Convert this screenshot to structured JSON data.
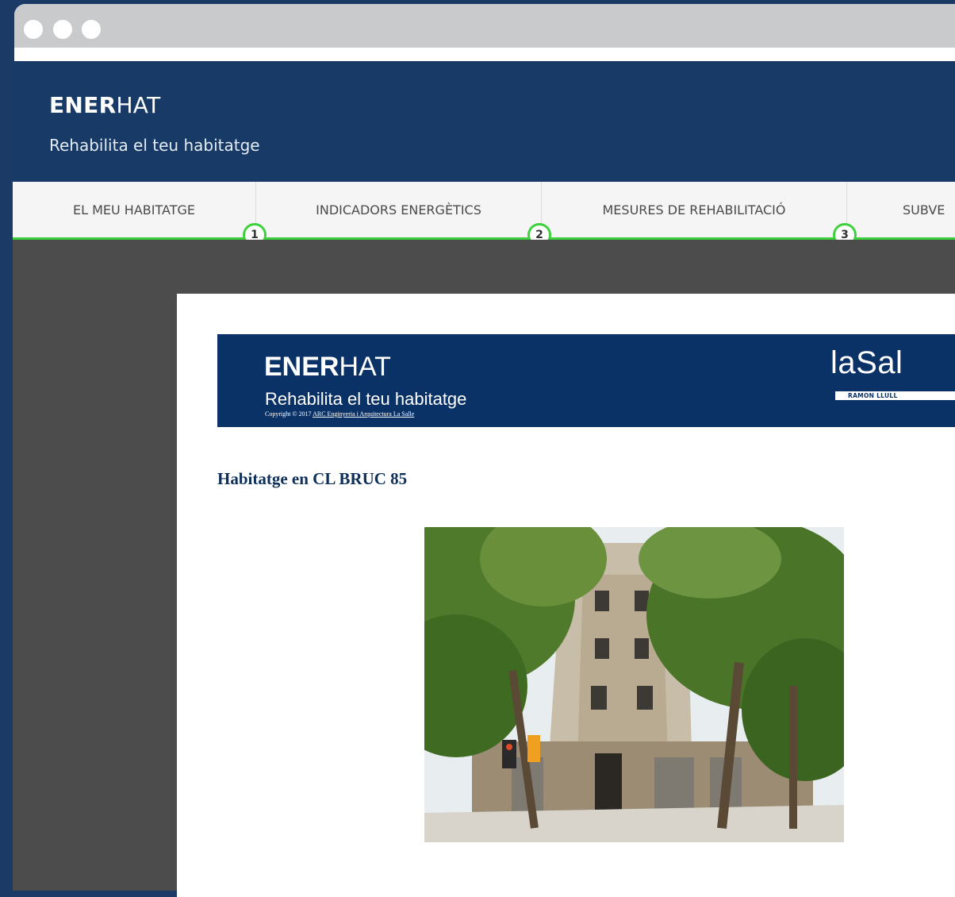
{
  "site": {
    "brand_bold": "ENER",
    "brand_light": "HAT",
    "tagline": "Rehabilita el teu habitatge"
  },
  "nav": {
    "items": [
      {
        "label": "EL MEU HABITATGE"
      },
      {
        "label": "INDICADORS ENERGÈTICS"
      },
      {
        "label": "MESURES DE REHABILITACIÓ"
      },
      {
        "label": "SUBVE"
      }
    ],
    "steps": [
      "1",
      "2",
      "3"
    ]
  },
  "document": {
    "banner": {
      "brand_bold": "ENER",
      "brand_light": "HAT",
      "tagline": "Rehabilita el teu habitatge",
      "copyright_prefix": "Copyright © 2017 ",
      "copyright_link": "ARC Enginyeria i Arquitectura La Salle",
      "partner_logo_text": "laSal",
      "partner_logo_subtext": "RAMON LLULL"
    },
    "heading": "Habitatge en CL BRUC 85"
  },
  "colors": {
    "header_bg": "#173a67",
    "banner_bg": "#0a3266",
    "progress_accent": "#3ed13e",
    "viewer_bg": "#4c4c4c"
  }
}
